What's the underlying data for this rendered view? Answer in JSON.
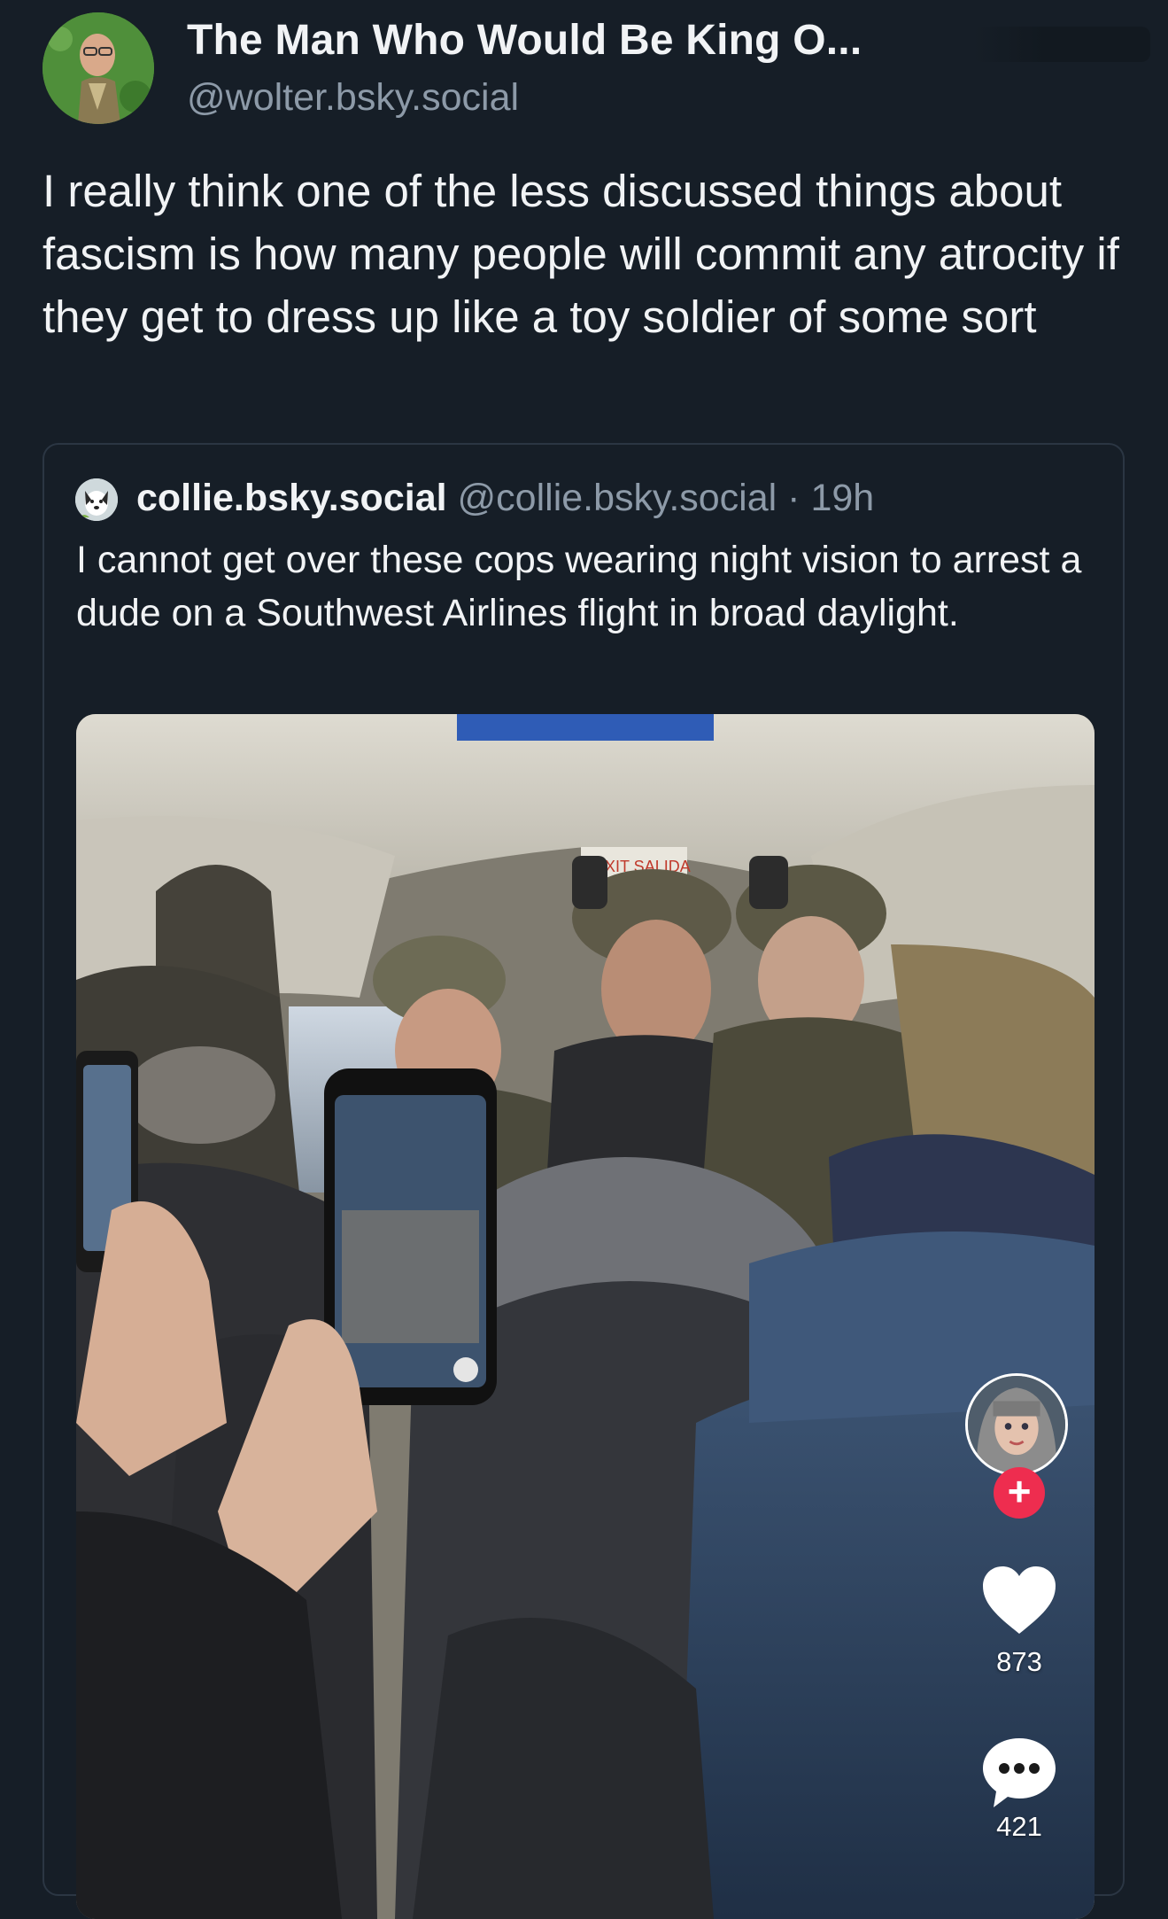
{
  "post": {
    "author": {
      "display_name": "The Man Who Would Be King O...",
      "handle": "@wolter.bsky.social",
      "avatar_icon": "user-avatar"
    },
    "text": "I really think one of the less discussed things about fascism is how many people will commit any atrocity if they get to dress up like a toy soldier of some sort"
  },
  "quoted_post": {
    "author": {
      "display_name": "collie.bsky.social",
      "handle": "@collie.bsky.social",
      "time": "19h",
      "avatar_icon": "dog-avatar"
    },
    "text": "I cannot get over these cops wearing night vision to arrest a dude on a Southwest Airlines flight in broad daylight.",
    "media": {
      "sign_text": "EXIT SALIDA",
      "overlay": {
        "follow_icon": "plus-icon",
        "like_icon": "heart-icon",
        "like_count": "873",
        "comment_icon": "comment-icon",
        "comment_count": "421"
      }
    }
  },
  "colors": {
    "background": "#161e27",
    "text": "#f1f3f5",
    "muted": "#8d9aa8",
    "border": "#2b3643",
    "follow_red": "#ee2d4f"
  }
}
